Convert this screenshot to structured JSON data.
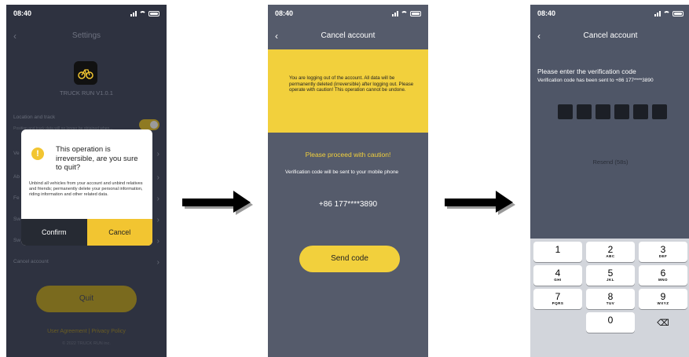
{
  "screen1": {
    "time": "08:40",
    "title": "Settings",
    "app_version": "TRUCK RUN V1.0.1",
    "track_title": "Location and track",
    "track_desc": "Position and track data will no longer be obtained when...",
    "rows": [
      "Ve",
      "Ab",
      "Fe",
      "Sw",
      "Sw"
    ],
    "cancel_account": "Cancel account",
    "quit_label": "Quit",
    "footer_links": "User Agreement  |  Privacy Policy",
    "copyright": "© 2022 TRUCK RUN inc.",
    "dialog": {
      "title": "This operation is irreversible, are you sure to quit?",
      "body": "Unbind all vehicles from your account and unbind relatives and friends; permanently delete your personal information, riding information and other related data.",
      "confirm_label": "Confirm",
      "cancel_label": "Cancel"
    }
  },
  "screen2": {
    "time": "08:40",
    "title": "Cancel account",
    "notice": "You are logging out of the account. All data will be permanently deleted (irreversible) after logging out. Please operate with caution! This operation cannot be undone.",
    "caution": "Please proceed with caution!",
    "send_note": "Verification code will be sent to your mobile phone",
    "phone_number": "+86 177****3890",
    "send_label": "Send code"
  },
  "screen3": {
    "time": "08:40",
    "title": "Cancel account",
    "enter_title": "Please enter the verification code",
    "sent_note": "Verification code has been sent to  +86 177****3890",
    "resend_label": "Resend (58s)",
    "keypad": [
      {
        "digit": "1",
        "letters": ""
      },
      {
        "digit": "2",
        "letters": "ABC"
      },
      {
        "digit": "3",
        "letters": "DEF"
      },
      {
        "digit": "4",
        "letters": "GHI"
      },
      {
        "digit": "5",
        "letters": "JKL"
      },
      {
        "digit": "6",
        "letters": "MNO"
      },
      {
        "digit": "7",
        "letters": "PQRS"
      },
      {
        "digit": "8",
        "letters": "TUV"
      },
      {
        "digit": "9",
        "letters": "WXYZ"
      },
      {
        "digit": "0",
        "letters": ""
      }
    ]
  },
  "colors": {
    "accent_yellow": "#f2d03c",
    "dark_bg": "#2e3240",
    "slate_bg": "#555b6b"
  }
}
